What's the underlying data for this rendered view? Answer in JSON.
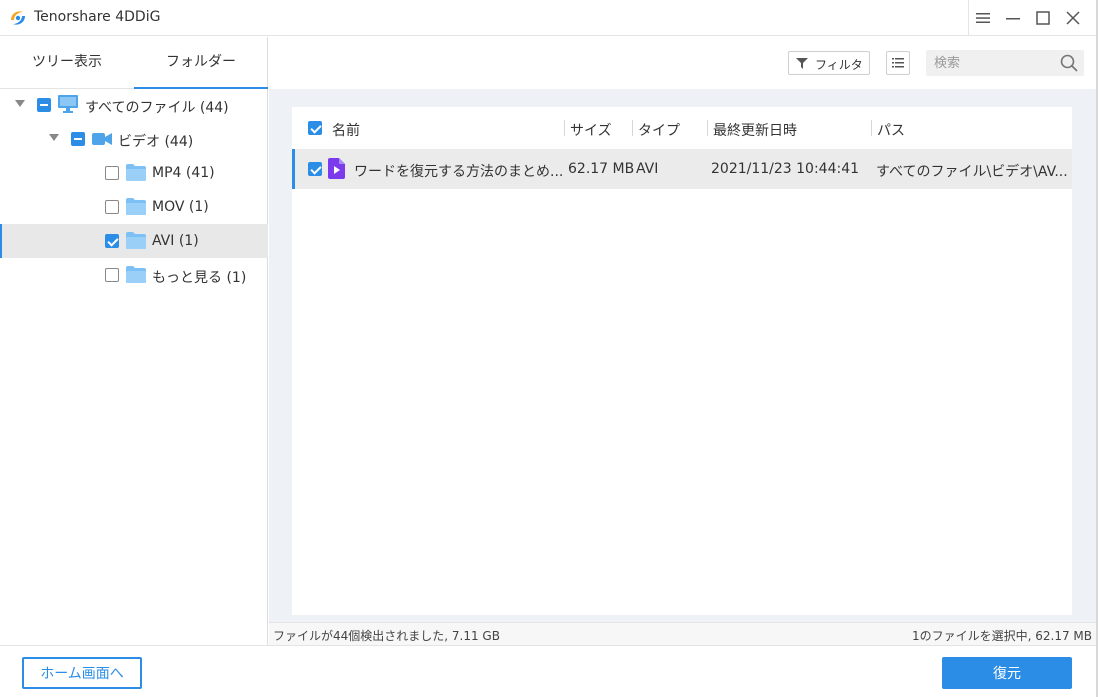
{
  "app": {
    "title": "Tenorshare 4DDiG"
  },
  "tabs": [
    {
      "label": "ツリー表示",
      "active": false
    },
    {
      "label": "フォルダー",
      "active": true
    }
  ],
  "tree": {
    "root_label": "すべてのファイル (44)",
    "video_label": "ビデオ (44)",
    "children": [
      {
        "label": "MP4 (41)",
        "checked": false
      },
      {
        "label": "MOV (1)",
        "checked": false
      },
      {
        "label": "AVI (1)",
        "checked": true
      },
      {
        "label": "もっと見る (1)",
        "checked": false
      }
    ]
  },
  "toolbar": {
    "filter_label": "フィルタ",
    "search_placeholder": "検索"
  },
  "list": {
    "columns": [
      "名前",
      "サイズ",
      "タイプ",
      "最終更新日時",
      "パス"
    ],
    "rows": [
      {
        "name": "ワードを復元する方法のまとめ...",
        "size": "62.17 MB",
        "type": "AVI",
        "modified": "2021/11/23 10:44:41",
        "path": "すべてのファイル\\ビデオ\\AV...",
        "checked": true
      }
    ]
  },
  "status": {
    "left": "ファイルが44個検出されました, 7.11 GB",
    "right": "1のファイルを選択中, 62.17 MB"
  },
  "footer": {
    "home_label": "ホーム画面へ",
    "recover_label": "復元"
  },
  "colors": {
    "accent": "#2b8de6",
    "video_icon": "#7c3aed"
  },
  "icons": [
    "app-logo-icon",
    "menu-icon",
    "minimize-icon",
    "maximize-icon",
    "close-icon",
    "computer-icon",
    "video-icon",
    "folder-icon",
    "filter-icon",
    "list-view-icon",
    "search-icon",
    "video-file-icon"
  ]
}
